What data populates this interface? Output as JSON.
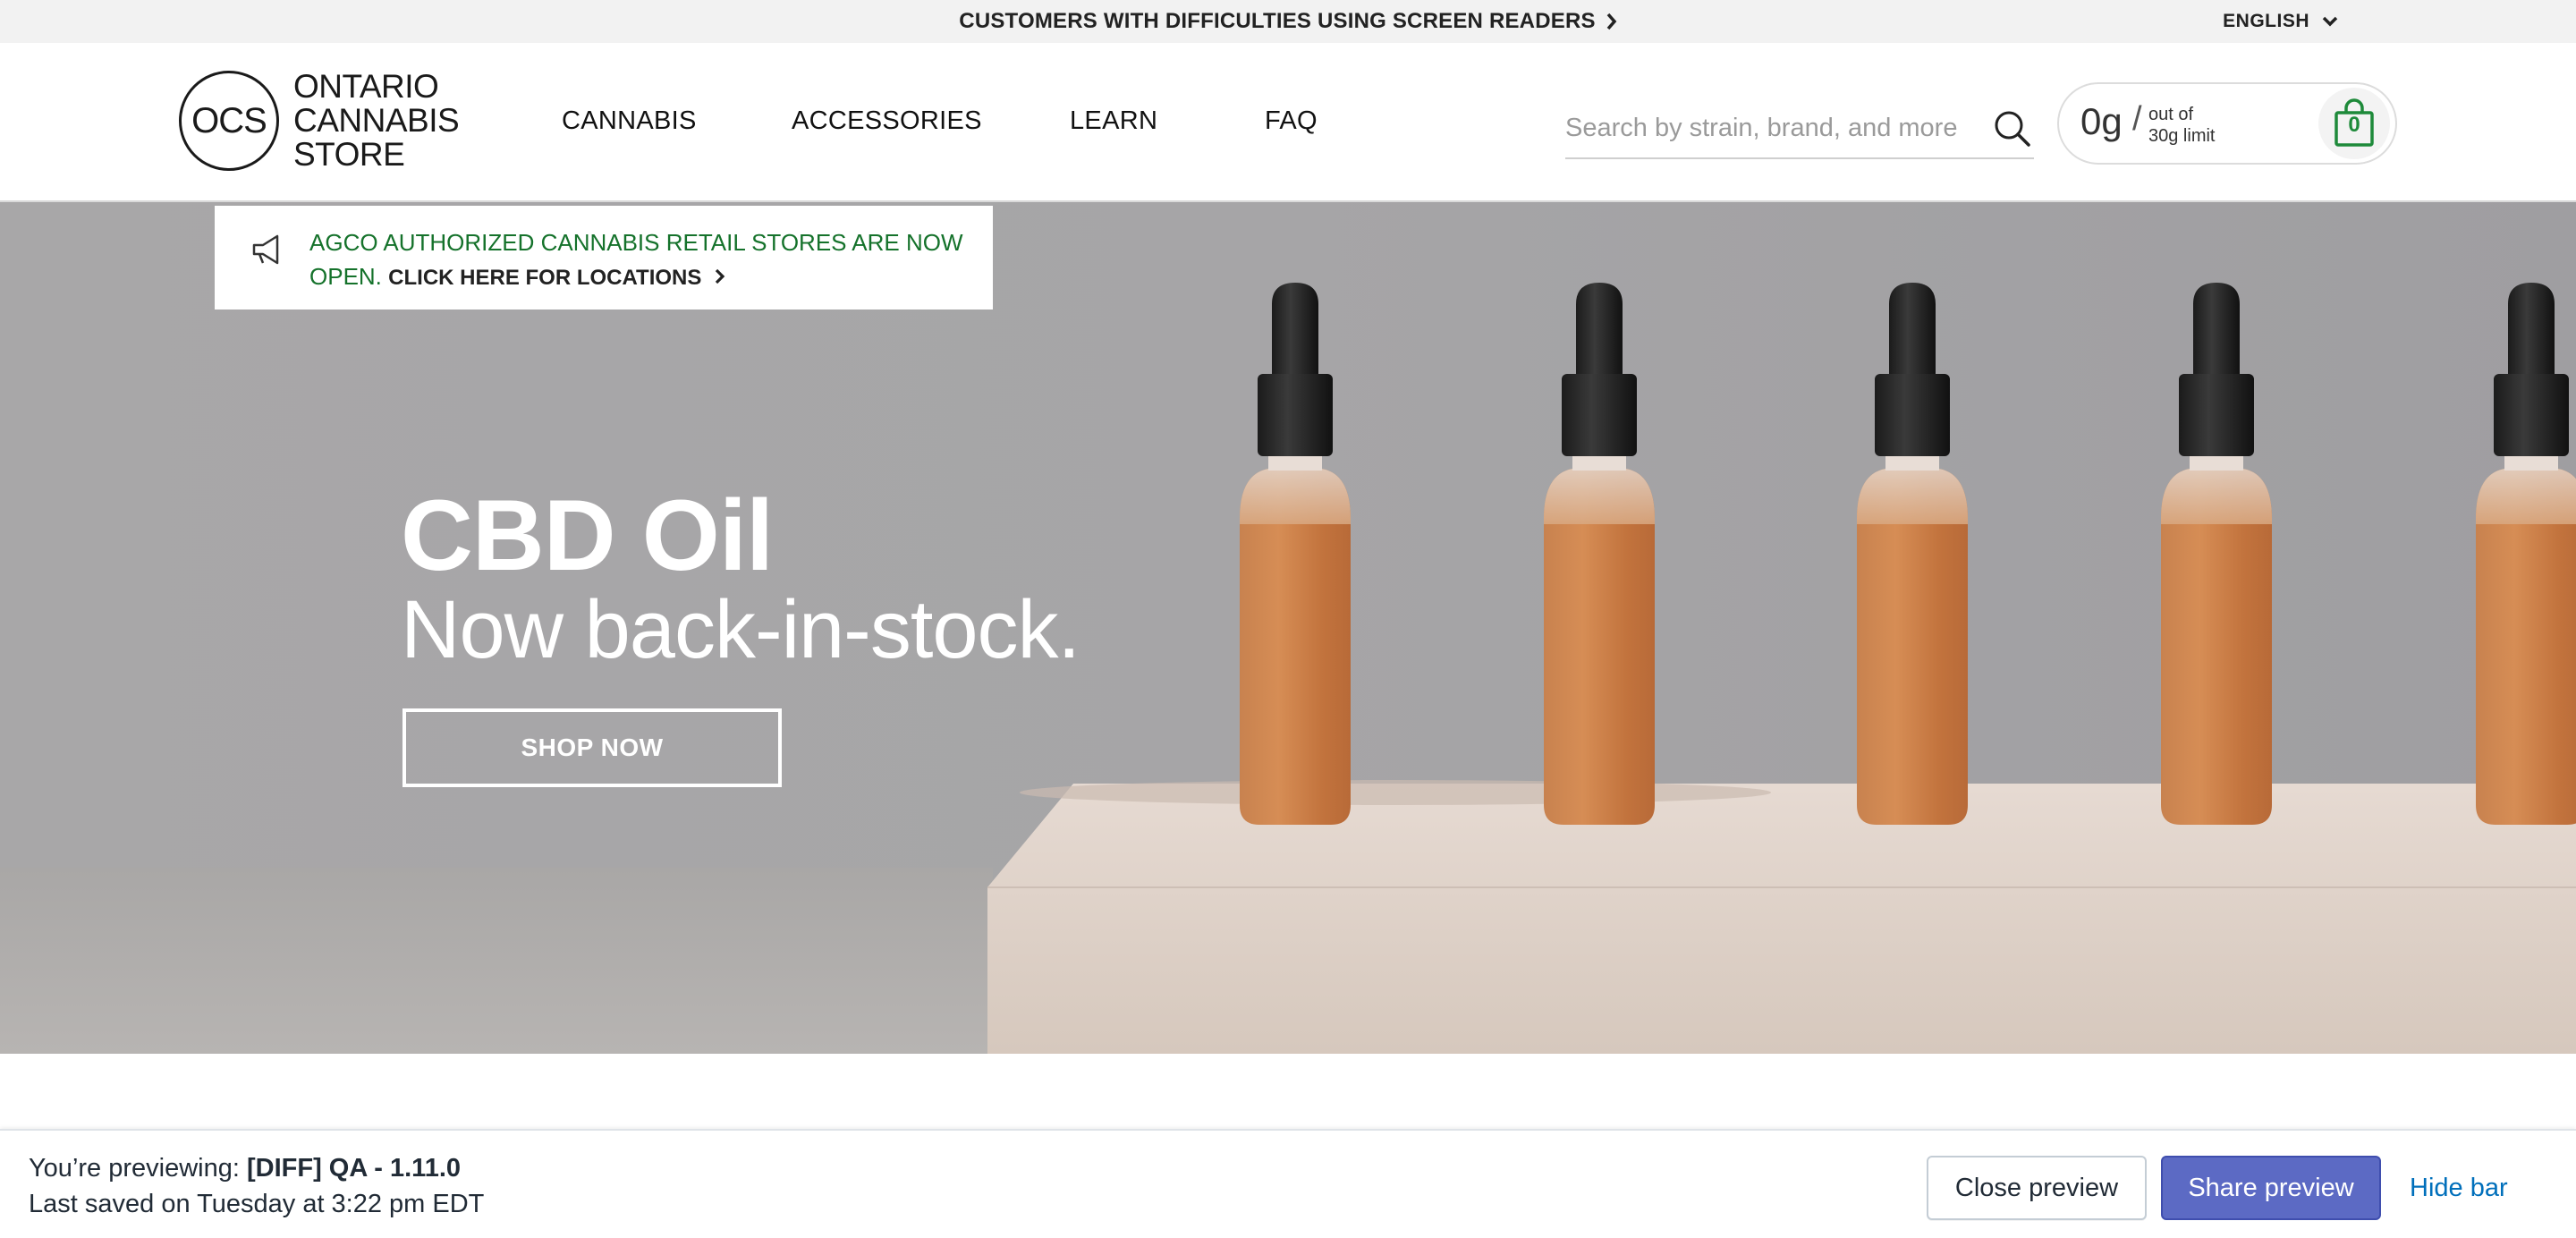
{
  "topbar": {
    "accessibility_link": "CUSTOMERS WITH DIFFICULTIES USING SCREEN READERS",
    "language": "ENGLISH"
  },
  "header": {
    "logo": {
      "mark": "OCS",
      "line1": "ONTARIO",
      "line2": "CANNABIS",
      "line3": "STORE"
    },
    "nav": [
      {
        "label": "CANNABIS"
      },
      {
        "label": "ACCESSORIES"
      },
      {
        "label": "LEARN"
      },
      {
        "label": "FAQ"
      }
    ],
    "search": {
      "placeholder": "Search by strain, brand, and more",
      "icon": "search-icon"
    },
    "purchase_limit": {
      "amount": "0g",
      "separator": "/",
      "line1": "out of",
      "line2": "30g limit"
    },
    "cart": {
      "count": "0",
      "icon": "shopping-bag-icon",
      "color": "#1e8a3a"
    }
  },
  "notice": {
    "icon": "megaphone-icon",
    "text": "AGCO AUTHORIZED CANNABIS RETAIL STORES ARE NOW OPEN.",
    "cta": "CLICK HERE FOR LOCATIONS",
    "text_color": "#15722b"
  },
  "hero": {
    "title": "CBD Oil",
    "subtitle": "Now back-in-stock.",
    "cta": "SHOP NOW",
    "background_color": "#a9a8a9"
  },
  "preview_bar": {
    "previewing_prefix": "You’re previewing:",
    "theme_name": "[DIFF] QA - 1.11.0",
    "last_saved": "Last saved on Tuesday at 3:22 pm EDT",
    "close_label": "Close preview",
    "share_label": "Share preview",
    "hide_label": "Hide bar",
    "accent": "#5c6ac4"
  }
}
